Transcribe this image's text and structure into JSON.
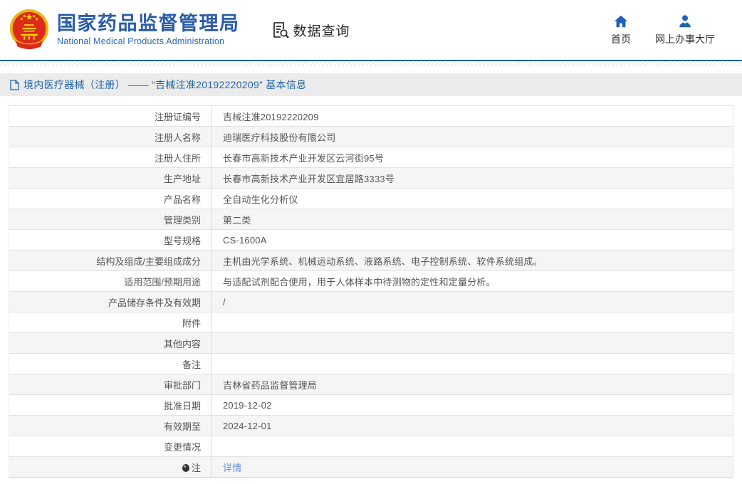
{
  "colors": {
    "brand_blue": "#2a5caa",
    "rule_blue": "#1a62b0",
    "nav_icon_blue": "#1e62b8",
    "breadcrumb_text_blue": "#2464a8",
    "link_blue": "#5b8dd6",
    "emblem_red": "#dd2a1b",
    "emblem_gold": "#e9b60c"
  },
  "header": {
    "title": "国家药品监督管理局",
    "subtitle": "National Medical Products Administration",
    "data_query_label": "数据查询",
    "nav_home": "首页",
    "nav_hall": "网上办事大厅"
  },
  "breadcrumb": {
    "text": "境内医疗器械（注册） —— “吉械注准20192220209” 基本信息"
  },
  "table": {
    "rows": [
      {
        "label": "注册证编号",
        "value": "吉械注准20192220209"
      },
      {
        "label": "注册人名称",
        "value": "迪瑞医疗科技股份有限公司"
      },
      {
        "label": "注册人住所",
        "value": "长春市高新技术产业开发区云河街95号"
      },
      {
        "label": "生产地址",
        "value": "长春市高新技术产业开发区宜居路3333号"
      },
      {
        "label": "产品名称",
        "value": "全自动生化分析仪"
      },
      {
        "label": "管理类别",
        "value": "第二类"
      },
      {
        "label": "型号规格",
        "value": "CS-1600A"
      },
      {
        "label": "结构及组成/主要组成成分",
        "value": "主机由光学系统、机械运动系统、液路系统、电子控制系统、软件系统组成。"
      },
      {
        "label": "适用范围/预期用途",
        "value": "与适配试剂配合使用，用于人体样本中待测物的定性和定量分析。"
      },
      {
        "label": "产品储存条件及有效期",
        "value": "/"
      },
      {
        "label": "附件",
        "value": ""
      },
      {
        "label": "其他内容",
        "value": ""
      },
      {
        "label": "备注",
        "value": ""
      },
      {
        "label": "审批部门",
        "value": "吉林省药品监督管理局"
      },
      {
        "label": "批准日期",
        "value": "2019-12-02"
      },
      {
        "label": "有效期至",
        "value": "2024-12-01"
      },
      {
        "label": "变更情况",
        "value": ""
      },
      {
        "label": "注",
        "label_icon": "bulb-icon",
        "value": "详情",
        "link": true
      }
    ]
  }
}
